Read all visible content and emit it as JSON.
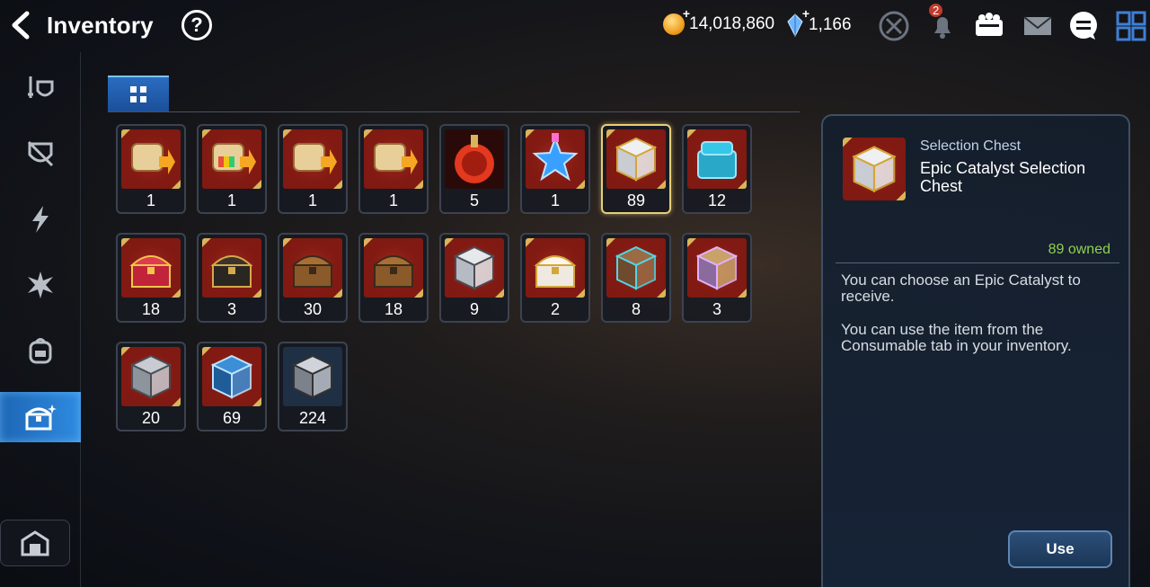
{
  "header": {
    "title": "Inventory",
    "help_label": "?",
    "gold": "14,018,860",
    "gems": "1,166",
    "notification_count": "2"
  },
  "colors": {
    "accent_blue": "#2f8be0",
    "selected_gold": "#e6cf7a",
    "owned_green": "#8fd14f",
    "slot_red": "#8a1c14"
  },
  "sidebar": {
    "items": [
      {
        "icon": "sword-shield-icon"
      },
      {
        "icon": "armor-icon"
      },
      {
        "icon": "lightning-icon"
      },
      {
        "icon": "burst-icon"
      },
      {
        "icon": "backpack-icon"
      },
      {
        "icon": "treasure-chest-icon",
        "active": true
      }
    ],
    "bottom_icon": "storehouse-icon"
  },
  "items": [
    {
      "icon": "scroll-upgrade-icon",
      "qty": "1"
    },
    {
      "icon": "scroll-rainbow-upgrade-icon",
      "qty": "1"
    },
    {
      "icon": "scroll-upgrade-icon",
      "qty": "1"
    },
    {
      "icon": "scroll-upgrade-icon",
      "qty": "1"
    },
    {
      "icon": "red-potion-icon",
      "qty": "5"
    },
    {
      "icon": "blue-star-potion-icon",
      "qty": "1"
    },
    {
      "icon": "white-gold-chest-icon",
      "qty": "89",
      "selected": true
    },
    {
      "icon": "cyan-chest-icon",
      "qty": "12"
    },
    {
      "icon": "red-chest-icon",
      "qty": "18"
    },
    {
      "icon": "black-gold-chest-icon",
      "qty": "3"
    },
    {
      "icon": "bronze-chest-icon",
      "qty": "30"
    },
    {
      "icon": "bronze-chest-icon",
      "qty": "18"
    },
    {
      "icon": "silver-chest-icon",
      "qty": "9"
    },
    {
      "icon": "pearl-chest-icon",
      "qty": "2"
    },
    {
      "icon": "rune-box-icon",
      "qty": "8"
    },
    {
      "icon": "violet-box-icon",
      "qty": "3"
    },
    {
      "icon": "grey-box-icon",
      "qty": "20"
    },
    {
      "icon": "blue-box-icon",
      "qty": "69"
    },
    {
      "icon": "dark-box-icon",
      "qty": "224"
    }
  ],
  "detail": {
    "type": "Selection Chest",
    "name": "Epic Catalyst Selection Chest",
    "owned": "89 owned",
    "desc1": "You can choose an Epic Catalyst to receive.",
    "desc2": "You can use the item from the Consumable tab in your inventory.",
    "use_label": "Use"
  }
}
